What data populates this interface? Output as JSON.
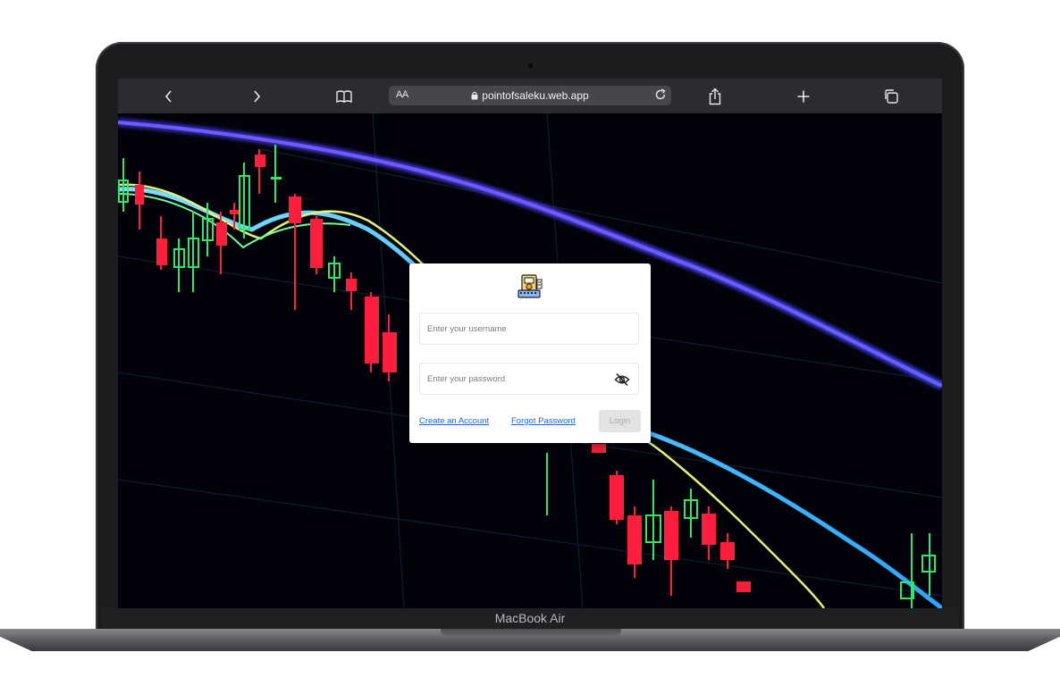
{
  "browser": {
    "url_aa_label": "AA",
    "url": "pointofsaleku.web.app",
    "icons": [
      "chevron-left-icon",
      "chevron-right-icon",
      "book-icon",
      "lock-icon",
      "reload-icon",
      "share-icon",
      "plus-icon",
      "tabs-icon"
    ]
  },
  "login": {
    "username_placeholder": "Enter your username",
    "password_placeholder": "Enter your password",
    "create_account": "Create an Account",
    "forgot_password": "Forgot Password",
    "login_button": "Login"
  },
  "device": {
    "model": "MacBook Air"
  },
  "colors": {
    "link": "#1a66e0",
    "candle_up": "#2ee86a",
    "candle_down": "#ff1f3d",
    "ma_purple": "#4b3cff",
    "ma_cyan": "#3cc8ff"
  }
}
